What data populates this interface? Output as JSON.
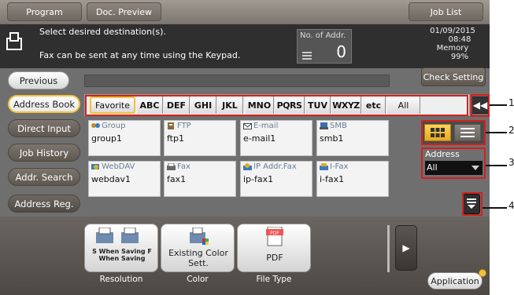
{
  "topbar": {
    "program": "Program",
    "doc_preview": "Doc. Preview",
    "job_list": "Job List"
  },
  "message": {
    "line1": "Select desired destination(s).",
    "line2": "Fax can be sent at any time using the Keypad.",
    "no_of_addr_label": "No. of Addr.",
    "no_of_addr_value": "0",
    "date": "01/09/2015",
    "time": "08:48",
    "memory_label": "Memory",
    "memory_value": "99%"
  },
  "previous": "Previous",
  "check_setting": "Check Setting",
  "left_menu": [
    "Address Book",
    "Direct Input",
    "Job History",
    "Addr. Search",
    "Address Reg."
  ],
  "index_tabs": [
    "Favorite",
    "ABC",
    "DEF",
    "GHI",
    "JKL",
    "MNO",
    "PQRS",
    "TUV",
    "WXYZ",
    "etc",
    "All"
  ],
  "destinations": [
    {
      "type": "Group",
      "name": "group1",
      "icon": "group-icon"
    },
    {
      "type": "FTP",
      "name": "ftp1",
      "icon": "ftp-icon"
    },
    {
      "type": "E-mail",
      "name": "e-mail1",
      "icon": "email-icon"
    },
    {
      "type": "SMB",
      "name": "smb1",
      "icon": "smb-icon"
    },
    {
      "type": "WebDAV",
      "name": "webdav1",
      "icon": "webdav-icon"
    },
    {
      "type": "Fax",
      "name": "fax1",
      "icon": "fax-icon"
    },
    {
      "type": "IP Addr.Fax",
      "name": "ip-fax1",
      "icon": "ip-fax-icon"
    },
    {
      "type": "I-Fax",
      "name": "i-fax1",
      "icon": "i-fax-icon"
    }
  ],
  "sort": {
    "label": "Address",
    "value": "All"
  },
  "functions": [
    {
      "button_text": "S When Saving F When Saving",
      "label": "Resolution"
    },
    {
      "button_text": "Existing Color Sett.",
      "label": "Color"
    },
    {
      "button_text": "PDF",
      "label": "File Type"
    }
  ],
  "application": "Application",
  "callouts": [
    "1",
    "2",
    "3",
    "4"
  ],
  "colors": {
    "highlight": "#f2c23a",
    "callout_red": "#d4201c",
    "dark_panel": "#2f2f2f"
  }
}
